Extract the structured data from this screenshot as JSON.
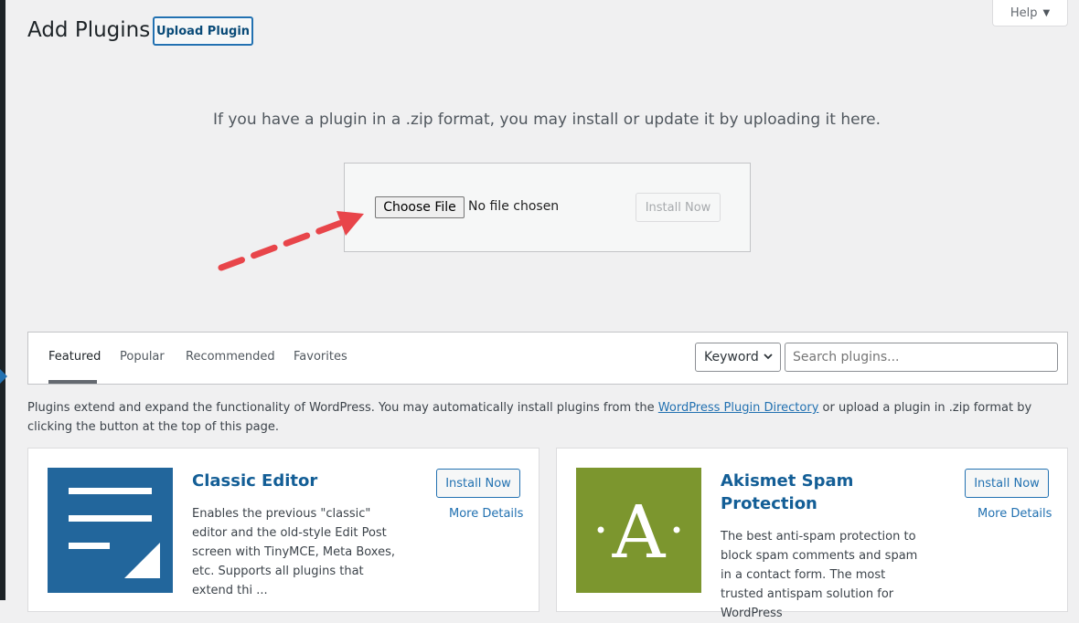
{
  "header": {
    "title": "Add Plugins",
    "upload_button": "Upload Plugin",
    "help_label": "Help"
  },
  "upload": {
    "instructions": "If you have a plugin in a .zip format, you may install or update it by uploading it here.",
    "choose_file": "Choose File",
    "no_file": "No file chosen",
    "install_now": "Install Now"
  },
  "filter": {
    "tabs": [
      {
        "label": "Featured",
        "active": true
      },
      {
        "label": "Popular"
      },
      {
        "label": "Recommended"
      },
      {
        "label": "Favorites"
      }
    ],
    "search_type": "Keyword",
    "search_placeholder": "Search plugins..."
  },
  "intro": {
    "text_before": "Plugins extend and expand the functionality of WordPress. You may automatically install plugins from the ",
    "link": "WordPress Plugin Directory",
    "text_after": " or upload a plugin in .zip format by clicking the button at the top of this page."
  },
  "plugins": [
    {
      "title": "Classic Editor",
      "description": "Enables the previous \"classic\" editor and the old-style Edit Post screen with TinyMCE, Meta Boxes, etc. Supports all plugins that extend thi ...",
      "install_label": "Install Now",
      "more_details": "More Details",
      "icon": "classic-editor-icon",
      "icon_color": "#22669c"
    },
    {
      "title": "Akismet Spam Protection",
      "description": "The best anti-spam protection to block spam comments and spam in a contact form. The most trusted antispam solution for WordPress",
      "install_label": "Install Now",
      "more_details": "More Details",
      "icon": "akismet-icon",
      "icon_letter": "A",
      "icon_color": "#7c962e"
    }
  ],
  "colors": {
    "accent": "#2271b1",
    "arrow": "#e8454a",
    "background": "#f0f0f1"
  }
}
